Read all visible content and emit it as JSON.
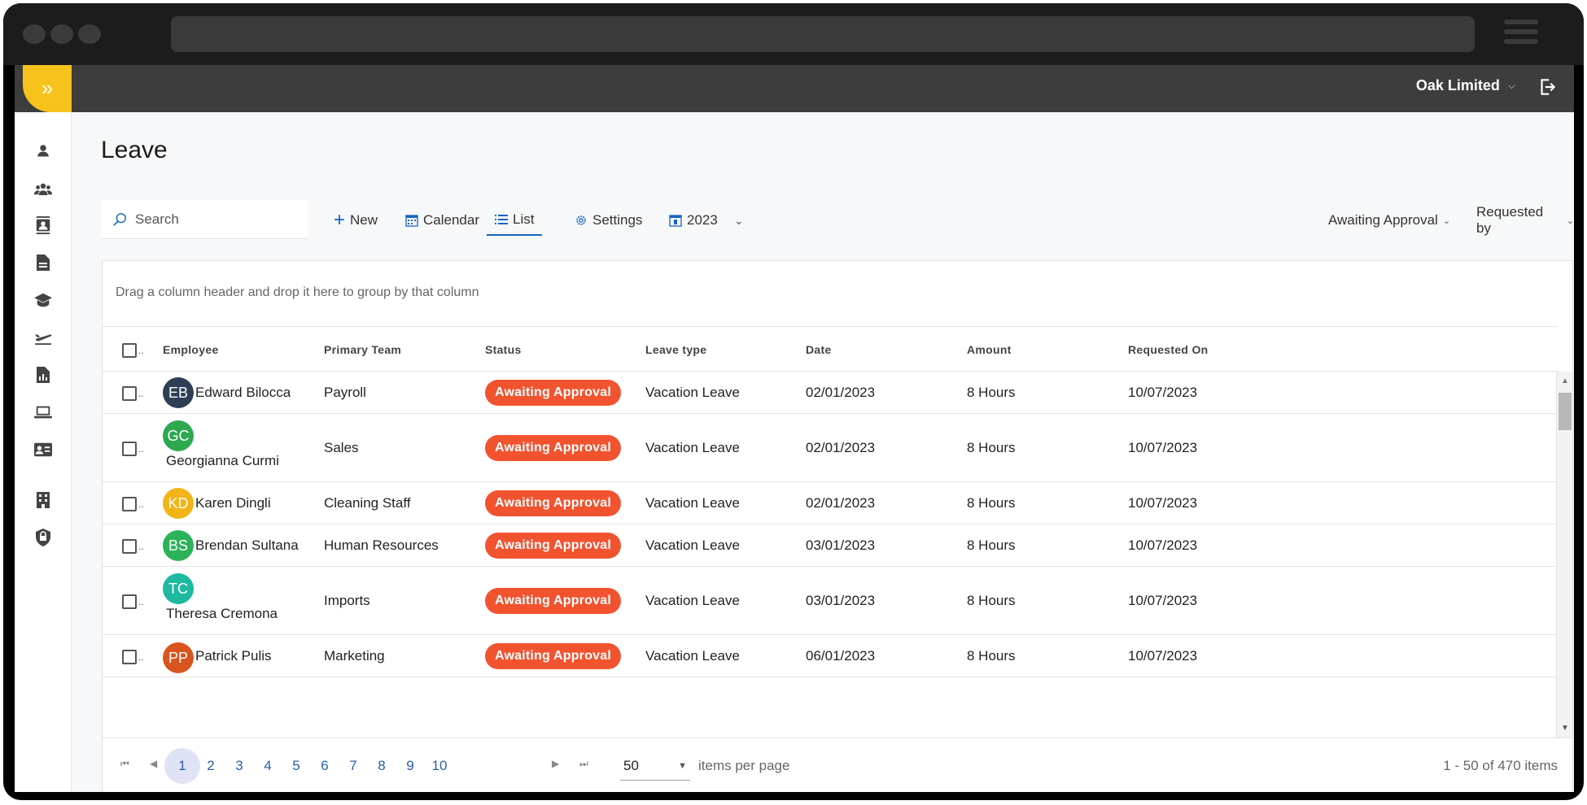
{
  "app": {
    "organization": "Oak Limited",
    "page_title": "Leave"
  },
  "sidebar": {
    "icons": [
      "person-icon",
      "team-icon",
      "contacts-icon",
      "document-icon",
      "graduation-cap-icon",
      "plane-icon",
      "report-icon",
      "laptop-icon",
      "id-card-icon",
      "building-icon",
      "shield-icon"
    ]
  },
  "toolbar": {
    "search_placeholder": "Search",
    "new_label": "New",
    "calendar_label": "Calendar",
    "list_label": "List",
    "settings_label": "Settings",
    "year_label": "2023",
    "status_filter": "Awaiting Approval",
    "requested_by_filter": "Requested by"
  },
  "grid": {
    "group_hint": "Drag a column header and drop it here to group by that column",
    "columns": [
      "Employee",
      "Primary Team",
      "Status",
      "Leave type",
      "Date",
      "Amount",
      "Requested On"
    ],
    "rows": [
      {
        "initials": "EB",
        "avatar_color": "#2e3e55",
        "employee": "Edward Bilocca",
        "team": "Payroll",
        "status": "Awaiting Approval",
        "leave_type": "Vacation Leave",
        "date": "02/01/2023",
        "amount": "8 Hours",
        "requested_on": "10/07/2023"
      },
      {
        "initials": "GC",
        "avatar_color": "#2ea84f",
        "employee": "Georgianna Curmi",
        "team": "Sales",
        "status": "Awaiting Approval",
        "leave_type": "Vacation Leave",
        "date": "02/01/2023",
        "amount": "8 Hours",
        "requested_on": "10/07/2023"
      },
      {
        "initials": "KD",
        "avatar_color": "#f2b416",
        "employee": "Karen Dingli",
        "team": "Cleaning Staff",
        "status": "Awaiting Approval",
        "leave_type": "Vacation Leave",
        "date": "02/01/2023",
        "amount": "8 Hours",
        "requested_on": "10/07/2023"
      },
      {
        "initials": "BS",
        "avatar_color": "#2bb35a",
        "employee": "Brendan Sultana",
        "team": "Human Resources",
        "status": "Awaiting Approval",
        "leave_type": "Vacation Leave",
        "date": "03/01/2023",
        "amount": "8 Hours",
        "requested_on": "10/07/2023"
      },
      {
        "initials": "TC",
        "avatar_color": "#1fb8a0",
        "employee": "Theresa Cremona",
        "team": "Imports",
        "status": "Awaiting Approval",
        "leave_type": "Vacation Leave",
        "date": "03/01/2023",
        "amount": "8 Hours",
        "requested_on": "10/07/2023"
      },
      {
        "initials": "PP",
        "avatar_color": "#d9541e",
        "employee": "Patrick Pulis",
        "team": "Marketing",
        "status": "Awaiting Approval",
        "leave_type": "Vacation Leave",
        "date": "06/01/2023",
        "amount": "8 Hours",
        "requested_on": "10/07/2023"
      }
    ]
  },
  "pager": {
    "pages": [
      "1",
      "2",
      "3",
      "4",
      "5",
      "6",
      "7",
      "8",
      "9",
      "10"
    ],
    "current_page": "1",
    "page_size": "50",
    "per_page_label": "items per page",
    "info": "1 - 50 of 470 items"
  },
  "colors": {
    "accent": "#f7c21b",
    "status_badge": "#f2532f",
    "topbar": "#3d3d3d",
    "link": "#2b5ca8"
  }
}
